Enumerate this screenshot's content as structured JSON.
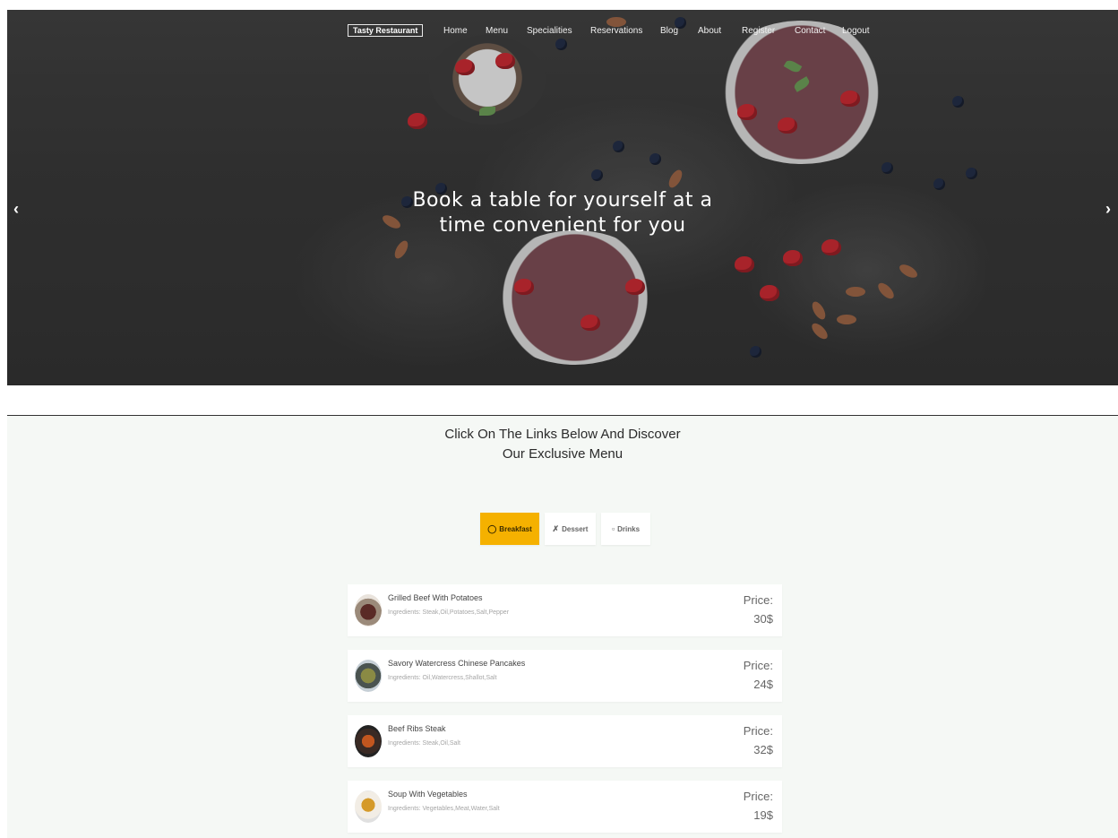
{
  "nav": {
    "brand": "Tasty Restaurant",
    "links": [
      "Home",
      "Menu",
      "Specialities",
      "Reservations",
      "Blog",
      "About",
      "Register",
      "Contact",
      "Logout"
    ]
  },
  "hero": {
    "title_line1": "Book a table for yourself at a",
    "title_line2": "time convenient for you",
    "prev_icon": "chevron-left-icon",
    "next_icon": "chevron-right-icon"
  },
  "menu_section": {
    "title_line1": "Click On The Links Below And Discover",
    "title_line2": "Our Exclusive Menu",
    "tabs": [
      {
        "label": "Breakfast",
        "icon": "food-icon",
        "active": true
      },
      {
        "label": "Dessert",
        "icon": "cutlery-icon",
        "active": false
      },
      {
        "label": "Drinks",
        "icon": "glasses-icon",
        "active": false
      }
    ],
    "items": [
      {
        "name": "Grilled Beef With Potatoes",
        "ingredients": "Ingredients: Steak,Oil,Potatoes,Salt,Pepper",
        "price_label": "Price:",
        "price": "30$"
      },
      {
        "name": "Savory Watercress Chinese Pancakes",
        "ingredients": "Ingredients: Oil,Watercress,Shallot,Salt",
        "price_label": "Price:",
        "price": "24$"
      },
      {
        "name": "Beef Ribs Steak",
        "ingredients": "Ingredients: Steak,Oil,Salt",
        "price_label": "Price:",
        "price": "32$"
      },
      {
        "name": "Soup With Vegetables",
        "ingredients": "Ingredients: Vegetables,Meat,Water,Salt",
        "price_label": "Price:",
        "price": "19$"
      }
    ]
  },
  "colors": {
    "accent": "#f5b100",
    "section_bg": "#f5f8f5",
    "hero_bg": "#353535"
  }
}
